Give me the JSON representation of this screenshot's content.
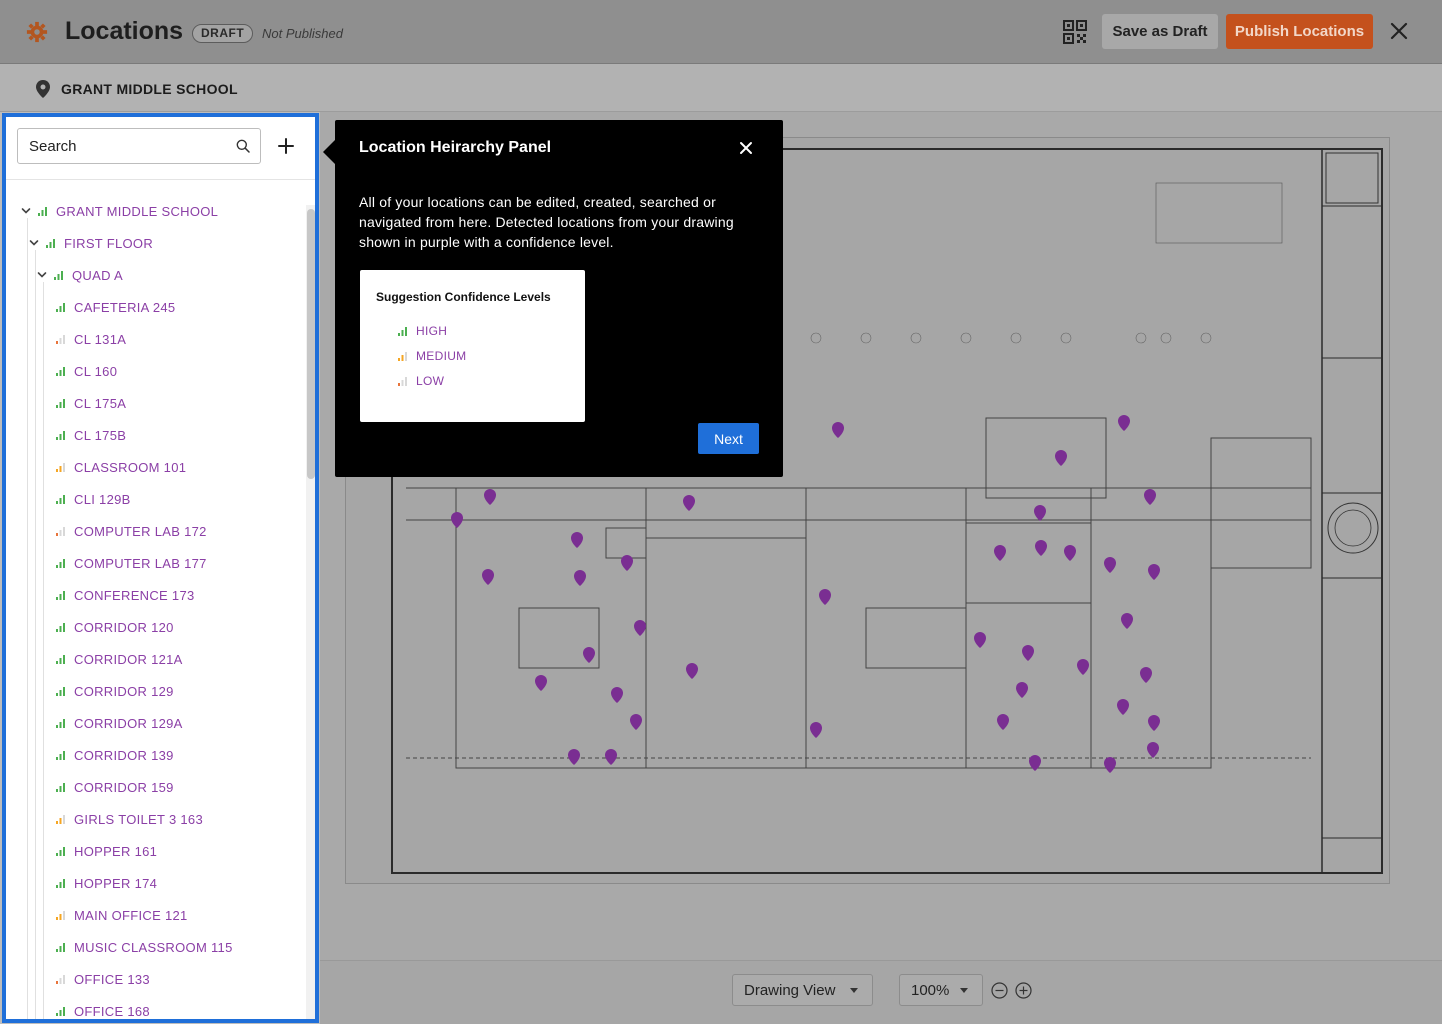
{
  "header": {
    "title": "Locations",
    "badge": "DRAFT",
    "status": "Not Published",
    "save_draft_label": "Save as Draft",
    "publish_label": "Publish Locations"
  },
  "subheader": {
    "location_name": "GRANT MIDDLE SCHOOL"
  },
  "sidebar": {
    "search_placeholder": "Search",
    "tree": [
      {
        "label": "GRANT MIDDLE SCHOOL",
        "level": 0,
        "expandable": true,
        "confidence": "high"
      },
      {
        "label": "FIRST FLOOR",
        "level": 1,
        "expandable": true,
        "confidence": "high"
      },
      {
        "label": "QUAD A",
        "level": 2,
        "expandable": true,
        "confidence": "high"
      },
      {
        "label": "CAFETERIA  245",
        "level": 3,
        "expandable": false,
        "confidence": "high"
      },
      {
        "label": "CL 131A",
        "level": 3,
        "expandable": false,
        "confidence": "low"
      },
      {
        "label": "CL 160",
        "level": 3,
        "expandable": false,
        "confidence": "high"
      },
      {
        "label": "CL 175A",
        "level": 3,
        "expandable": false,
        "confidence": "high"
      },
      {
        "label": "CL 175B",
        "level": 3,
        "expandable": false,
        "confidence": "high"
      },
      {
        "label": "CLASSROOM 101",
        "level": 3,
        "expandable": false,
        "confidence": "medium"
      },
      {
        "label": "CLI 129B",
        "level": 3,
        "expandable": false,
        "confidence": "high"
      },
      {
        "label": "COMPUTER LAB 172",
        "level": 3,
        "expandable": false,
        "confidence": "low"
      },
      {
        "label": "COMPUTER LAB 177",
        "level": 3,
        "expandable": false,
        "confidence": "high"
      },
      {
        "label": "CONFERENCE 173",
        "level": 3,
        "expandable": false,
        "confidence": "high"
      },
      {
        "label": "CORRIDOR 120",
        "level": 3,
        "expandable": false,
        "confidence": "high"
      },
      {
        "label": "CORRIDOR 121A",
        "level": 3,
        "expandable": false,
        "confidence": "high"
      },
      {
        "label": "CORRIDOR 129",
        "level": 3,
        "expandable": false,
        "confidence": "high"
      },
      {
        "label": "CORRIDOR 129A",
        "level": 3,
        "expandable": false,
        "confidence": "high"
      },
      {
        "label": "CORRIDOR 139",
        "level": 3,
        "expandable": false,
        "confidence": "high"
      },
      {
        "label": "CORRIDOR 159",
        "level": 3,
        "expandable": false,
        "confidence": "high"
      },
      {
        "label": "GIRLS TOILET 3 163",
        "level": 3,
        "expandable": false,
        "confidence": "medium"
      },
      {
        "label": "HOPPER 161",
        "level": 3,
        "expandable": false,
        "confidence": "high"
      },
      {
        "label": "HOPPER 174",
        "level": 3,
        "expandable": false,
        "confidence": "high"
      },
      {
        "label": "MAIN OFFICE 121",
        "level": 3,
        "expandable": false,
        "confidence": "medium"
      },
      {
        "label": "MUSIC CLASSROOM 115",
        "level": 3,
        "expandable": false,
        "confidence": "high"
      },
      {
        "label": "OFFICE 133",
        "level": 3,
        "expandable": false,
        "confidence": "low"
      },
      {
        "label": "OFFICE 168",
        "level": 3,
        "expandable": false,
        "confidence": "high"
      }
    ]
  },
  "popover": {
    "title": "Location Heirarchy Panel",
    "body": "All of your locations can be edited, created, searched or navigated from here. Detected locations from your drawing shown in purple with a confidence level.",
    "levels_title": "Suggestion Confidence Levels",
    "levels": [
      {
        "label": "HIGH",
        "confidence": "high"
      },
      {
        "label": "MEDIUM",
        "confidence": "medium"
      },
      {
        "label": "LOW",
        "confidence": "low"
      }
    ],
    "next_label": "Next"
  },
  "bottom": {
    "view_label": "Drawing View",
    "zoom_label": "100%"
  },
  "colors": {
    "accent_blue": "#1f6fd9",
    "publish_orange": "#c4511d",
    "location_purple": "#8b3fa6",
    "confidence_high": "#4caf50",
    "confidence_medium": "#f5a623",
    "confidence_low": "#e8743b"
  },
  "icons": {
    "app": "gear-icon",
    "qr": "qr-code-icon",
    "close": "close-icon",
    "pin": "map-pin-icon",
    "search": "search-icon",
    "add": "plus-icon",
    "expand": "chevron-down-icon",
    "confidence": "signal-bars-icon",
    "zoom_out": "zoom-out-icon",
    "zoom_in": "zoom-in-icon"
  }
}
